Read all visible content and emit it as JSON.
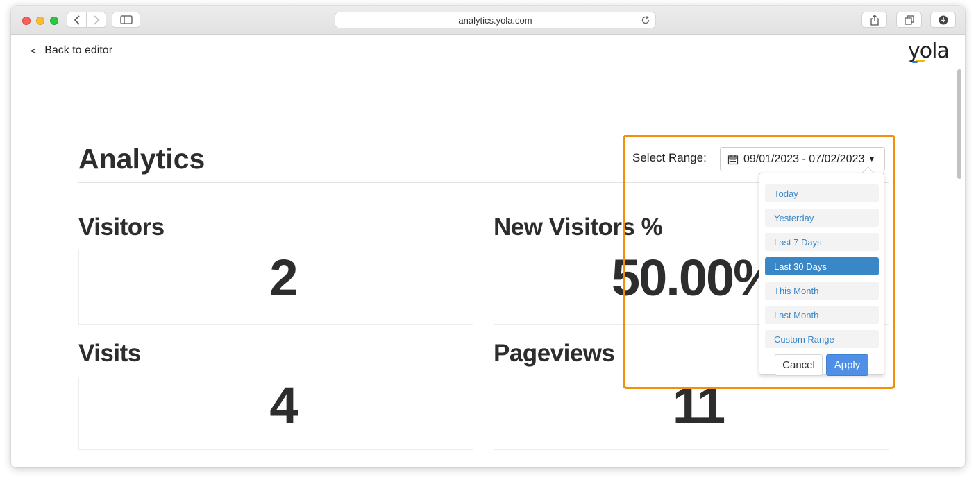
{
  "browser": {
    "url": "analytics.yola.com"
  },
  "appbar": {
    "back_chevron": "<",
    "back_label": "Back to editor",
    "logo_text": "yola"
  },
  "page": {
    "title": "Analytics"
  },
  "metrics": [
    {
      "label": "Visitors",
      "value": "2"
    },
    {
      "label": "New Visitors %",
      "value": "50.00%"
    },
    {
      "label": "Visits",
      "value": "4"
    },
    {
      "label": "Pageviews",
      "value": "11"
    }
  ],
  "range_picker": {
    "label": "Select Range:",
    "value": "09/01/2023 - 07/02/2023",
    "options": [
      "Today",
      "Yesterday",
      "Last 7 Days",
      "Last 30 Days",
      "This Month",
      "Last Month",
      "Custom Range"
    ],
    "selected": "Last 30 Days",
    "cancel_label": "Cancel",
    "apply_label": "Apply"
  },
  "colors": {
    "highlight": "#f2900a",
    "accent": "#3a87c8",
    "apply": "#4f8fe6"
  }
}
